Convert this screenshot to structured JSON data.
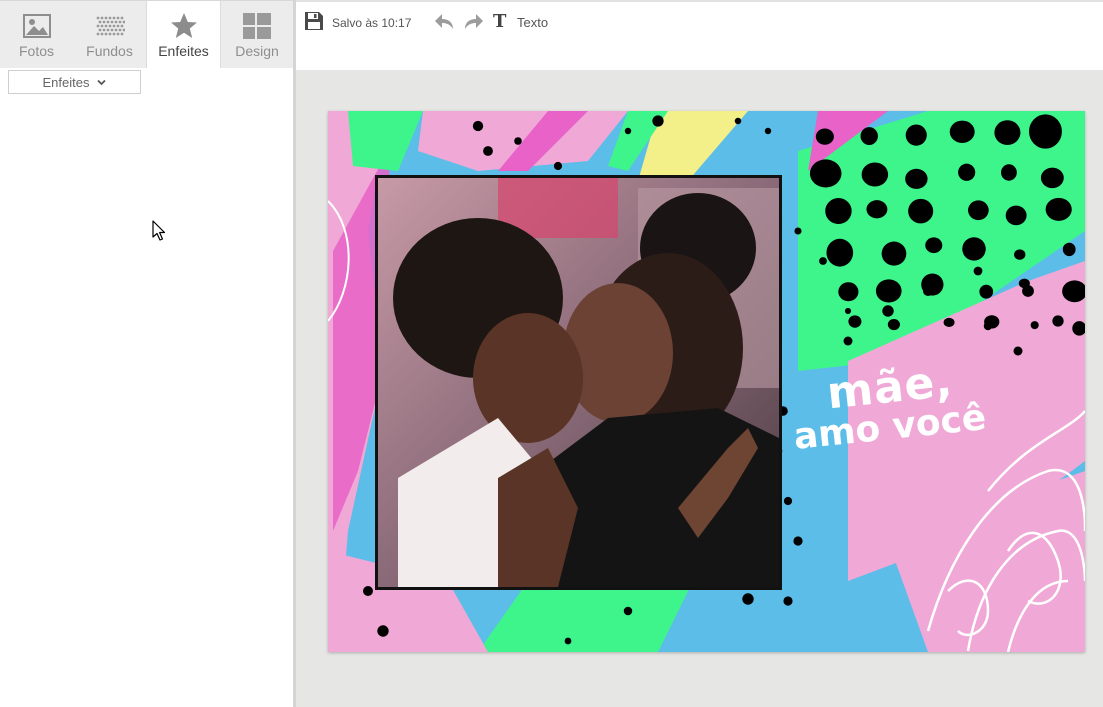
{
  "tabs": [
    {
      "label": "Fotos",
      "icon": "image-icon"
    },
    {
      "label": "Fundos",
      "icon": "pattern-icon"
    },
    {
      "label": "Enfeites",
      "icon": "star-icon"
    },
    {
      "label": "Design",
      "icon": "layout-icon"
    }
  ],
  "active_tab": "Enfeites",
  "sidebar": {
    "dropdown": {
      "value": "Enfeites"
    }
  },
  "toolbar": {
    "save_status": "Salvo às 10:17",
    "text_button": "Texto"
  },
  "card": {
    "headline_line1": "mãe,",
    "headline_line2": "amo você"
  },
  "colors": {
    "blue": "#5cbde8",
    "pink": "#f0a9d6",
    "green": "#3ef58c",
    "magenta": "#e862c7",
    "yellow": "#f3f08a"
  }
}
